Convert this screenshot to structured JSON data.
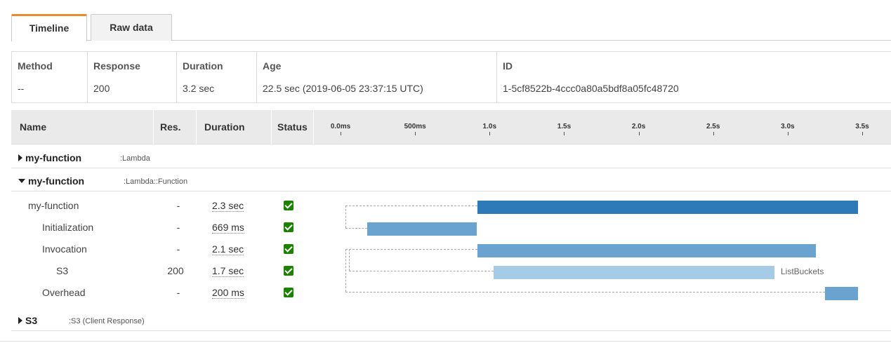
{
  "tabs": {
    "timeline_label": "Timeline",
    "raw_label": "Raw data"
  },
  "summary": {
    "method": {
      "header": "Method",
      "value": "--"
    },
    "response": {
      "header": "Response",
      "value": "200"
    },
    "duration": {
      "header": "Duration",
      "value": "3.2 sec"
    },
    "age": {
      "header": "Age",
      "value": "22.5 sec (2019-06-05 23:37:15 UTC)"
    },
    "id": {
      "header": "ID",
      "value": "1-5cf8522b-4ccc0a80a5bdf8a05fc48720"
    }
  },
  "timeline": {
    "columns": {
      "name": "Name",
      "res": "Res.",
      "duration": "Duration",
      "status": "Status"
    },
    "ticks": [
      "0.0ms",
      "500ms",
      "1.0s",
      "1.5s",
      "2.0s",
      "2.5s",
      "3.0s",
      "3.5s"
    ],
    "groups": [
      {
        "name": "my-function",
        "type": ":Lambda",
        "expanded": false
      },
      {
        "name": "my-function",
        "type": ":Lambda::Function",
        "expanded": true
      },
      {
        "name": "S3",
        "type": ":S3 (Client Response)",
        "expanded": false
      }
    ],
    "segments": [
      {
        "name": "my-function",
        "res": "-",
        "duration": "2.3 sec",
        "status": "ok",
        "annotation": ""
      },
      {
        "name": "Initialization",
        "res": "-",
        "duration": "669 ms",
        "status": "ok",
        "annotation": ""
      },
      {
        "name": "Invocation",
        "res": "-",
        "duration": "2.1 sec",
        "status": "ok",
        "annotation": ""
      },
      {
        "name": "S3",
        "res": "200",
        "duration": "1.7 sec",
        "status": "ok",
        "annotation": "ListBuckets"
      },
      {
        "name": "Overhead",
        "res": "-",
        "duration": "200 ms",
        "status": "ok",
        "annotation": ""
      }
    ]
  },
  "colors": {
    "tab_accent": "#e88b2f",
    "bar_dark": "#2e7ab8",
    "bar_mid": "#6aa3d0",
    "bar_light": "#a6cbe6",
    "status_ok": "#1d8102"
  }
}
